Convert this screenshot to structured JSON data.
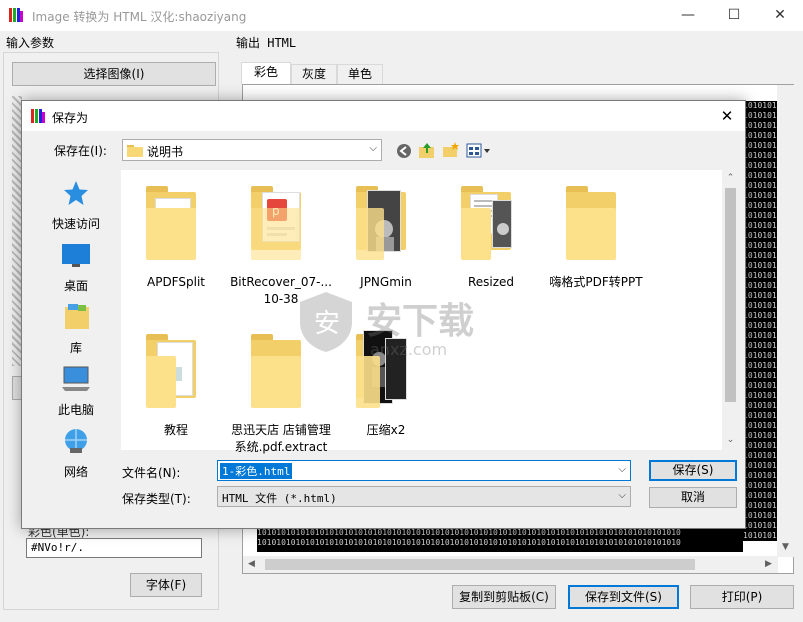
{
  "window": {
    "title": "Image 转换为 HTML   汉化:shaoziyang",
    "controls": {
      "minimize": "—",
      "maximize": "☐",
      "close": "✕"
    }
  },
  "left_panel": {
    "title": "输入参数",
    "select_image_button": "选择图像(I)",
    "color_label": "彩色(单色):",
    "color_value": "#NVo!r/.",
    "font_button": "字体(F)"
  },
  "right_panel": {
    "title": "输出 HTML",
    "tabs": [
      "彩色",
      "灰度",
      "单色"
    ],
    "active_tab": "彩色",
    "binary_text": "1010101010101010101010101010101010101010101010101010101010101010101010101010101010101010"
  },
  "bottom_buttons": {
    "copy": "复制到剪贴板(C)",
    "save": "保存到文件(S)",
    "print": "打印(P)"
  },
  "dialog": {
    "title": "保存为",
    "save_in_label": "保存在(I):",
    "save_in_value": "说明书",
    "places": [
      {
        "label": "快速访问",
        "icon": "star-icon"
      },
      {
        "label": "桌面",
        "icon": "desktop-icon"
      },
      {
        "label": "库",
        "icon": "library-icon"
      },
      {
        "label": "此电脑",
        "icon": "computer-icon"
      },
      {
        "label": "网络",
        "icon": "network-icon"
      }
    ],
    "files": [
      {
        "name": "APDFSplit",
        "icon": "folder-icon"
      },
      {
        "name": "BitRecover_07-...\n10-38",
        "icon": "folder-icon"
      },
      {
        "name": "JPNGmin",
        "icon": "folder-icon"
      },
      {
        "name": "Resized",
        "icon": "folder-icon"
      },
      {
        "name": "嗨格式PDF转PPT",
        "icon": "folder-icon"
      },
      {
        "name": "教程",
        "icon": "folder-icon"
      },
      {
        "name": "思迅天店 店铺管理\n系统.pdf.extract",
        "icon": "folder-icon"
      },
      {
        "name": "压缩x2",
        "icon": "folder-icon"
      }
    ],
    "filename_label": "文件名(N):",
    "filename_value": "1-彩色.html",
    "filetype_label": "保存类型(T):",
    "filetype_value": "HTML 文件 (*.html)",
    "save_button": "保存(S)",
    "cancel_button": "取消",
    "close": "✕"
  },
  "watermark": {
    "text": "安下载",
    "sub": "anxz.com"
  }
}
